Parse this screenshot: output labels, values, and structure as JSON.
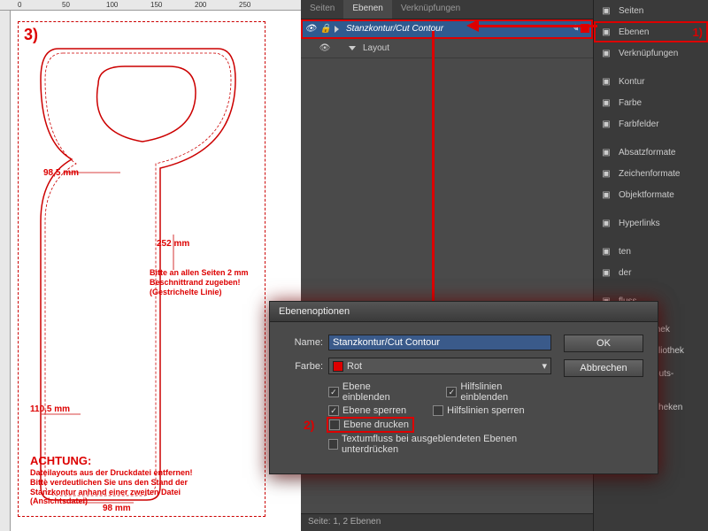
{
  "ruler": {
    "marks": [
      "0",
      "50",
      "100",
      "150",
      "200",
      "250"
    ]
  },
  "artwork": {
    "step3": "3)",
    "dim_top": "98,5 mm",
    "dim_mid": "252 mm",
    "note_mid": "Bitte an allen Seiten 2 mm\nBeschnittrand zugeben!\n(Gestrichelte Linie)",
    "dim_left": "110,5 mm",
    "warning_title": "ACHTUNG:",
    "warning_text": "Dateilayouts aus der Druckdatei entfernen!\nBitte verdeutlichen Sie uns den Stand der\nStanzkontur anhand einer zweiten Datei\n(Ansichtsdatei)",
    "dim_bottom": "98 mm"
  },
  "layers_panel": {
    "tabs": [
      "Seiten",
      "Ebenen",
      "Verknüpfungen"
    ],
    "active_tab": 1,
    "layers": [
      {
        "name": "Stanzkontur/Cut Contour",
        "selected": true
      },
      {
        "name": "Layout",
        "selected": false
      }
    ],
    "footer": "Seite: 1, 2 Ebenen"
  },
  "side_panel": {
    "items": [
      {
        "name": "Seiten",
        "icon": "pages-icon"
      },
      {
        "name": "Ebenen",
        "icon": "layers-icon",
        "highlight": true,
        "step": "1)"
      },
      {
        "name": "Verknüpfungen",
        "icon": "links-icon"
      },
      {
        "_sep": true
      },
      {
        "name": "Kontur",
        "icon": "stroke-icon"
      },
      {
        "name": "Farbe",
        "icon": "color-icon"
      },
      {
        "name": "Farbfelder",
        "icon": "swatches-icon"
      },
      {
        "_sep": true
      },
      {
        "name": "Absatzformate",
        "icon": "para-styles-icon"
      },
      {
        "name": "Zeichenformate",
        "icon": "char-styles-icon"
      },
      {
        "name": "Objektformate",
        "icon": "obj-styles-icon"
      },
      {
        "_sep": true
      },
      {
        "name": "Hyperlinks",
        "icon": "hyperlinks-icon"
      },
      {
        "_sep": true
      },
      {
        "name": "ten",
        "icon": "generic-icon"
      },
      {
        "name": "der",
        "icon": "generic-icon"
      },
      {
        "_sep": true
      },
      {
        "name": "fluss",
        "icon": "generic-icon"
      },
      {
        "_sep": true
      },
      {
        "name": "ag-Bibliothek",
        "icon": "library-icon"
      },
      {
        "name": "Media-Bibliothek",
        "icon": "library-icon"
      },
      {
        "_sep": true
      },
      {
        "name": "Print-Layouts-Biblioth",
        "icon": "library-icon"
      },
      {
        "_sep": true
      },
      {
        "name": "CC-Bibliotheken",
        "icon": "cc-icon"
      }
    ]
  },
  "dialog": {
    "title": "Ebenenoptionen",
    "name_label": "Name:",
    "name_value": "Stanzkontur/Cut Contour",
    "color_label": "Farbe:",
    "color_value": "Rot",
    "ok": "OK",
    "cancel": "Abbrechen",
    "checks": {
      "show_layer": "Ebene einblenden",
      "show_guides": "Hilfslinien einblenden",
      "lock_layer": "Ebene sperren",
      "lock_guides": "Hilfslinien sperren",
      "print_layer": "Ebene drucken",
      "suppress_wrap": "Textumfluss bei ausgeblendeten Ebenen unterdrücken"
    },
    "step2": "2)"
  }
}
